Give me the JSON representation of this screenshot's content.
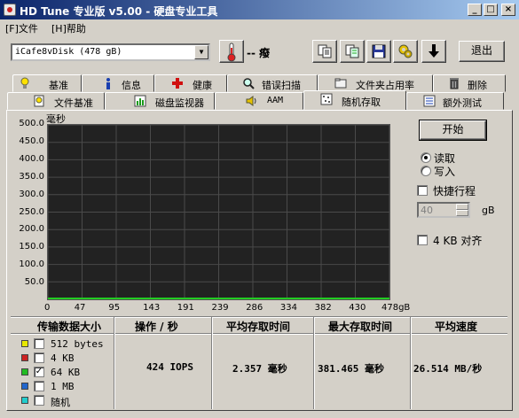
{
  "window": {
    "title": "HD Tune 专业版 v5.00 - 硬盘专业工具"
  },
  "menu": [
    "[F]文件",
    "[H]帮助"
  ],
  "toolbar": {
    "drive": "iCafe8vDisk (478 gB)",
    "temperature": "-- 癈",
    "exit_label": "退出"
  },
  "tabs_row1": [
    {
      "label": "基准",
      "icon": "lightbulb-icon"
    },
    {
      "label": "信息",
      "icon": "info-icon"
    },
    {
      "label": "健康",
      "icon": "health-cross-icon"
    },
    {
      "label": "错误扫描",
      "icon": "magnifier-icon"
    },
    {
      "label": "文件夹占用率",
      "icon": "folder-icon"
    },
    {
      "label": "删除",
      "icon": "trash-icon"
    }
  ],
  "tabs_row2": [
    {
      "label": "文件基准",
      "icon": "file-bulb-icon"
    },
    {
      "label": "磁盘监视器",
      "icon": "monitor-chart-icon"
    },
    {
      "label": "AAM",
      "icon": "speaker-icon"
    },
    {
      "label": "随机存取",
      "icon": "random-dots-icon",
      "active": true
    },
    {
      "label": "额外测试",
      "icon": "extra-test-icon"
    }
  ],
  "chart_data": {
    "type": "scatter",
    "ylabel": "毫秒",
    "y_ticks": [
      "500.0",
      "450.0",
      "400.0",
      "350.0",
      "300.0",
      "250.0",
      "200.0",
      "150.0",
      "100.0",
      "50.0"
    ],
    "x_ticks": [
      "0",
      "47",
      "95",
      "143",
      "191",
      "239",
      "286",
      "334",
      "382",
      "430",
      "478gB"
    ],
    "ylim": [
      0,
      500
    ],
    "xlim": [
      0,
      478
    ],
    "grid": true,
    "background": "#222222",
    "series": [
      {
        "color": "#22cc22",
        "note": "64 KB",
        "y_level": 2.4
      }
    ]
  },
  "controls": {
    "start_label": "开始",
    "read_label": "读取",
    "write_label": "写入",
    "short_stroke_label": "快捷行程",
    "short_stroke_value": "40",
    "short_stroke_unit": "gB",
    "align_label": "4 KB 对齐"
  },
  "table": {
    "headers": [
      "传输数据大小",
      "操作 / 秒",
      "平均存取时间",
      "最大存取时间",
      "平均速度"
    ],
    "rows": [
      {
        "label": "512 bytes",
        "color": "#e8e800",
        "checked": false
      },
      {
        "label": "4 KB",
        "color": "#cc2222",
        "checked": false
      },
      {
        "label": "64 KB",
        "color": "#22bb22",
        "checked": true
      },
      {
        "label": "1 MB",
        "color": "#2266cc",
        "checked": false
      },
      {
        "label": "随机",
        "color": "#22cccc",
        "checked": false
      }
    ],
    "result": {
      "ops": "424 IOPS",
      "avg_access": "2.357 毫秒",
      "max_access": "381.465 毫秒",
      "avg_speed": "26.514 MB/秒"
    }
  }
}
